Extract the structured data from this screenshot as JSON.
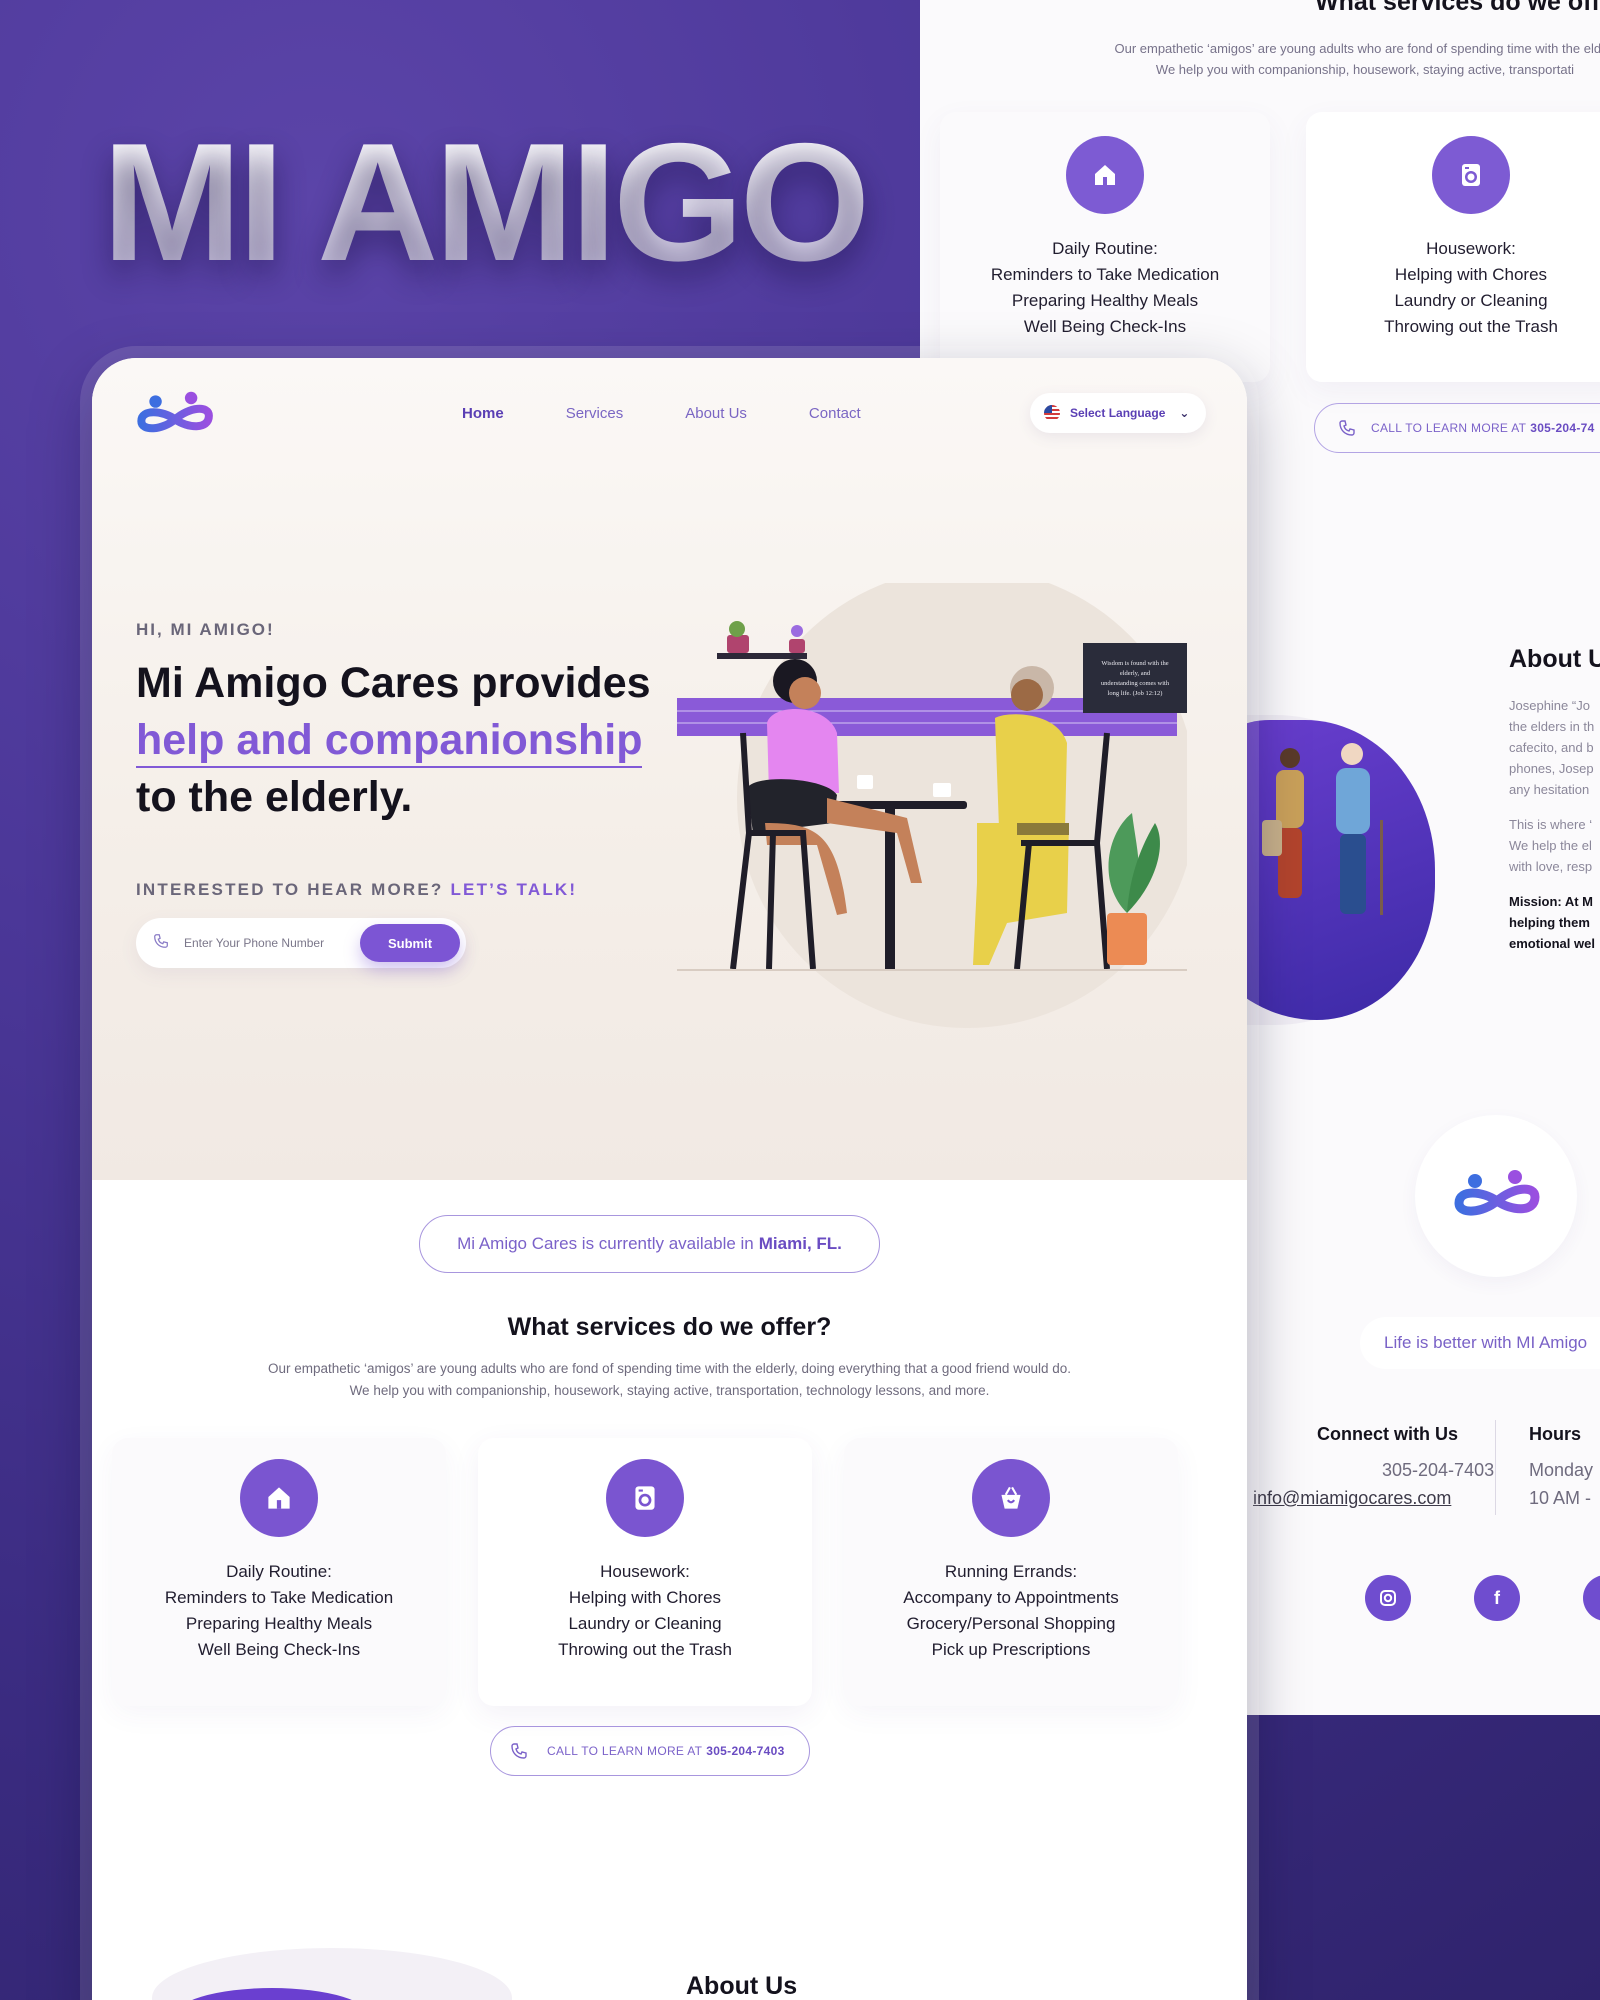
{
  "brand": {
    "title": "MI AMIGO",
    "accent_color": "#7c55d4",
    "background_color": "#3b2d7e"
  },
  "main": {
    "nav": {
      "logo": "mi-amigo-logo",
      "items": [
        {
          "label": "Home",
          "active": true
        },
        {
          "label": "Services",
          "active": false
        },
        {
          "label": "About Us",
          "active": false
        },
        {
          "label": "Contact",
          "active": false
        }
      ],
      "language_label": "Select Language"
    },
    "hero": {
      "kicker": "HI, MI AMIGO!",
      "headline_line1": "Mi Amigo Cares provides",
      "headline_accent": "help and companionship",
      "headline_line3": "to the elderly.",
      "talk_prefix": "INTERESTED TO HEAR MORE?",
      "talk_accent": "LET’S TALK!",
      "phone_placeholder": "Enter Your Phone Number",
      "submit_label": "Submit",
      "sign_text": "Wisdom is found with the elderly, and understanding comes with long life. (Job 12:12)"
    },
    "availability": {
      "prefix": "Mi Amigo Cares is currently available in",
      "location": "Miami, FL."
    },
    "services": {
      "title": "What services do we offer?",
      "desc_line1": "Our empathetic ‘amigos’ are young adults who are fond of spending time with the elderly, doing everything that a good friend would do.",
      "desc_line2": "We help you with companionship, housework, staying active, transportation, technology lessons, and more.",
      "cards": [
        {
          "icon": "home-icon",
          "title": "Daily Routine:",
          "lines": [
            "Reminders to Take Medication",
            "Preparing Healthy Meals",
            "Well Being Check-Ins"
          ]
        },
        {
          "icon": "washer-icon",
          "title": "Housework:",
          "lines": [
            "Helping with Chores",
            "Laundry or Cleaning",
            "Throwing out the Trash"
          ]
        },
        {
          "icon": "shopping-basket-icon",
          "title": "Running Errands:",
          "lines": [
            "Accompany to Appointments",
            "Grocery/Personal Shopping",
            "Pick up Prescriptions"
          ]
        }
      ],
      "call_prefix": "CALL TO LEARN MORE AT",
      "call_number": "305-204-7403"
    },
    "about": {
      "title": "About Us"
    }
  },
  "back_page": {
    "services_title": "What services do we offer",
    "desc_line1": "Our empathetic ‘amigos’ are young adults who are fond of spending time with the elderl",
    "desc_line2": "We help you with companionship, housework, staying active, transportati",
    "cards": [
      {
        "title": "Daily Routine:",
        "lines": [
          "Reminders to Take Medication",
          "Preparing Healthy Meals",
          "Well Being Check-Ins"
        ]
      },
      {
        "title": "Housework:",
        "lines": [
          "Helping with Chores",
          "Laundry or Cleaning",
          "Throwing out the Trash"
        ]
      }
    ],
    "call_prefix": "CALL TO LEARN MORE AT",
    "call_number": "305-204-74",
    "about_title": "About U",
    "about_lines_a": [
      "Josephine “Jo",
      "the elders in th",
      "cafecito, and b",
      "phones, Josep",
      "any hesitation"
    ],
    "about_lines_b": [
      "This is where ‘",
      "We help the el",
      "with love, resp"
    ],
    "about_lines_c": [
      "Mission: At M",
      "helping them",
      "emotional wel"
    ],
    "tagline": "Life is better with MI Amigo",
    "connect_title": "Connect with Us",
    "connect_phone": "305-204-7403",
    "connect_email": "info@miamigocares.com",
    "hours_title": "Hours",
    "hours_day": "Monday",
    "hours_time": "10 AM -",
    "socials": [
      "instagram-icon",
      "facebook-icon",
      "twitter-icon"
    ]
  }
}
